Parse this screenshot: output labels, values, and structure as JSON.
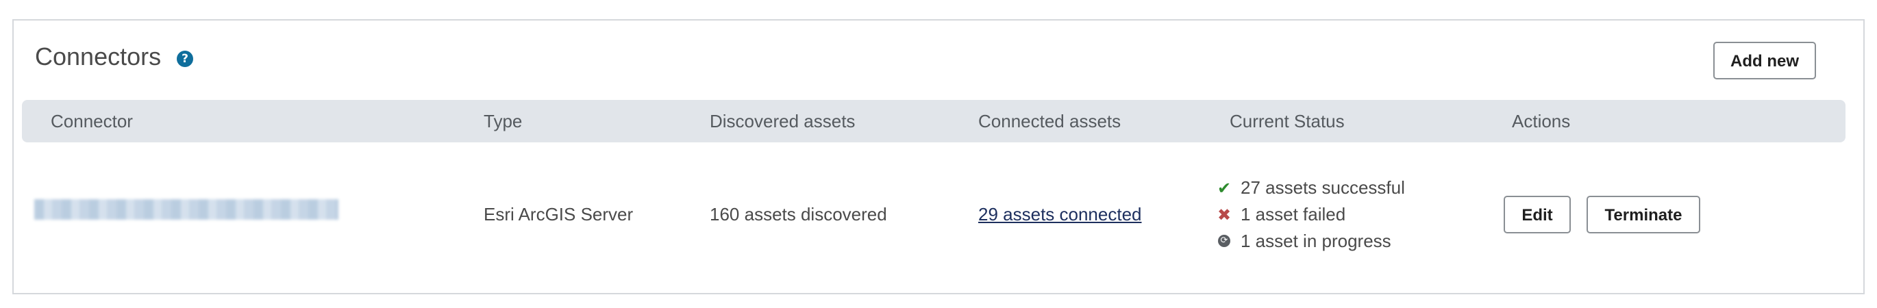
{
  "header": {
    "title": "Connectors",
    "help_icon": "question-circle-icon",
    "add_button": "Add new"
  },
  "table": {
    "columns": [
      "Connector",
      "Type",
      "Discovered assets",
      "Connected assets",
      "Current Status",
      "Actions"
    ],
    "rows": [
      {
        "connector": "",
        "type": "Esri ArcGIS Server",
        "discovered": "160 assets discovered",
        "connected": "29 assets connected",
        "status": [
          {
            "icon": "check-icon",
            "text": "27 assets successful"
          },
          {
            "icon": "x-icon",
            "text": "1 asset failed"
          },
          {
            "icon": "in-progress-icon",
            "text": "1 asset in progress"
          }
        ],
        "actions": {
          "edit": "Edit",
          "terminate": "Terminate"
        }
      }
    ]
  },
  "colors": {
    "header_bg": "#e1e5ea",
    "help_icon": "#0f6e9c",
    "success": "#2e8b2e",
    "failed": "#b84a4a",
    "link": "#1d2f5e"
  }
}
